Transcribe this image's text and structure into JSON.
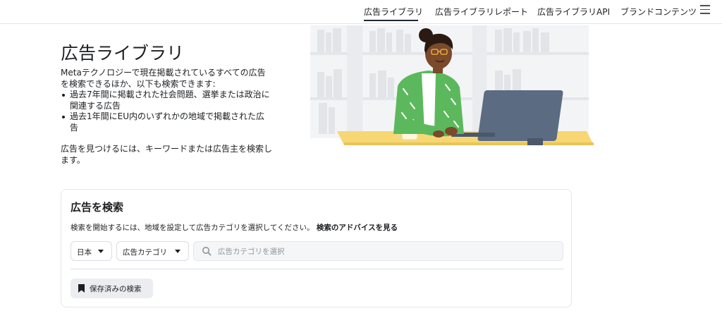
{
  "nav": {
    "items": [
      {
        "label": "広告ライブラリ",
        "active": true
      },
      {
        "label": "広告ライブラリレポート",
        "active": false
      },
      {
        "label": "広告ライブラリAPI",
        "active": false
      },
      {
        "label": "ブランドコンテンツ",
        "active": false
      }
    ],
    "menu_icon": "hamburger-menu-icon"
  },
  "hero": {
    "title": "広告ライブラリ",
    "description": "Metaテクノロジーで現在掲載されているすべての広告を検索できるほか、以下も検索できます:",
    "bullets": [
      "過去7年間に掲載された社会問題、選挙または政治に関連する広告",
      "過去1年間にEU内のいずれかの地域で掲載された広告"
    ],
    "tip": "広告を見つけるには、キーワードまたは広告主を検索します。"
  },
  "search": {
    "title": "広告を検索",
    "help_text": "検索を開始するには、地域を設定して広告カテゴリを選択してください。",
    "help_link": "検索のアドバイスを見る",
    "country_value": "日本",
    "category_value": "広告カテゴリ",
    "input_placeholder": "広告カテゴリを選択",
    "search_icon": "search-icon",
    "saved_label": "保存済みの検索",
    "saved_icon": "bookmark-icon"
  },
  "colors": {
    "accent_underline": "#1c2b33",
    "input_bg": "#f5f6f7",
    "button_bg": "#ebedf0",
    "illustration_shirt": "#5cb85c",
    "illustration_desk": "#f7d774",
    "illustration_monitor": "#5b6b82"
  }
}
